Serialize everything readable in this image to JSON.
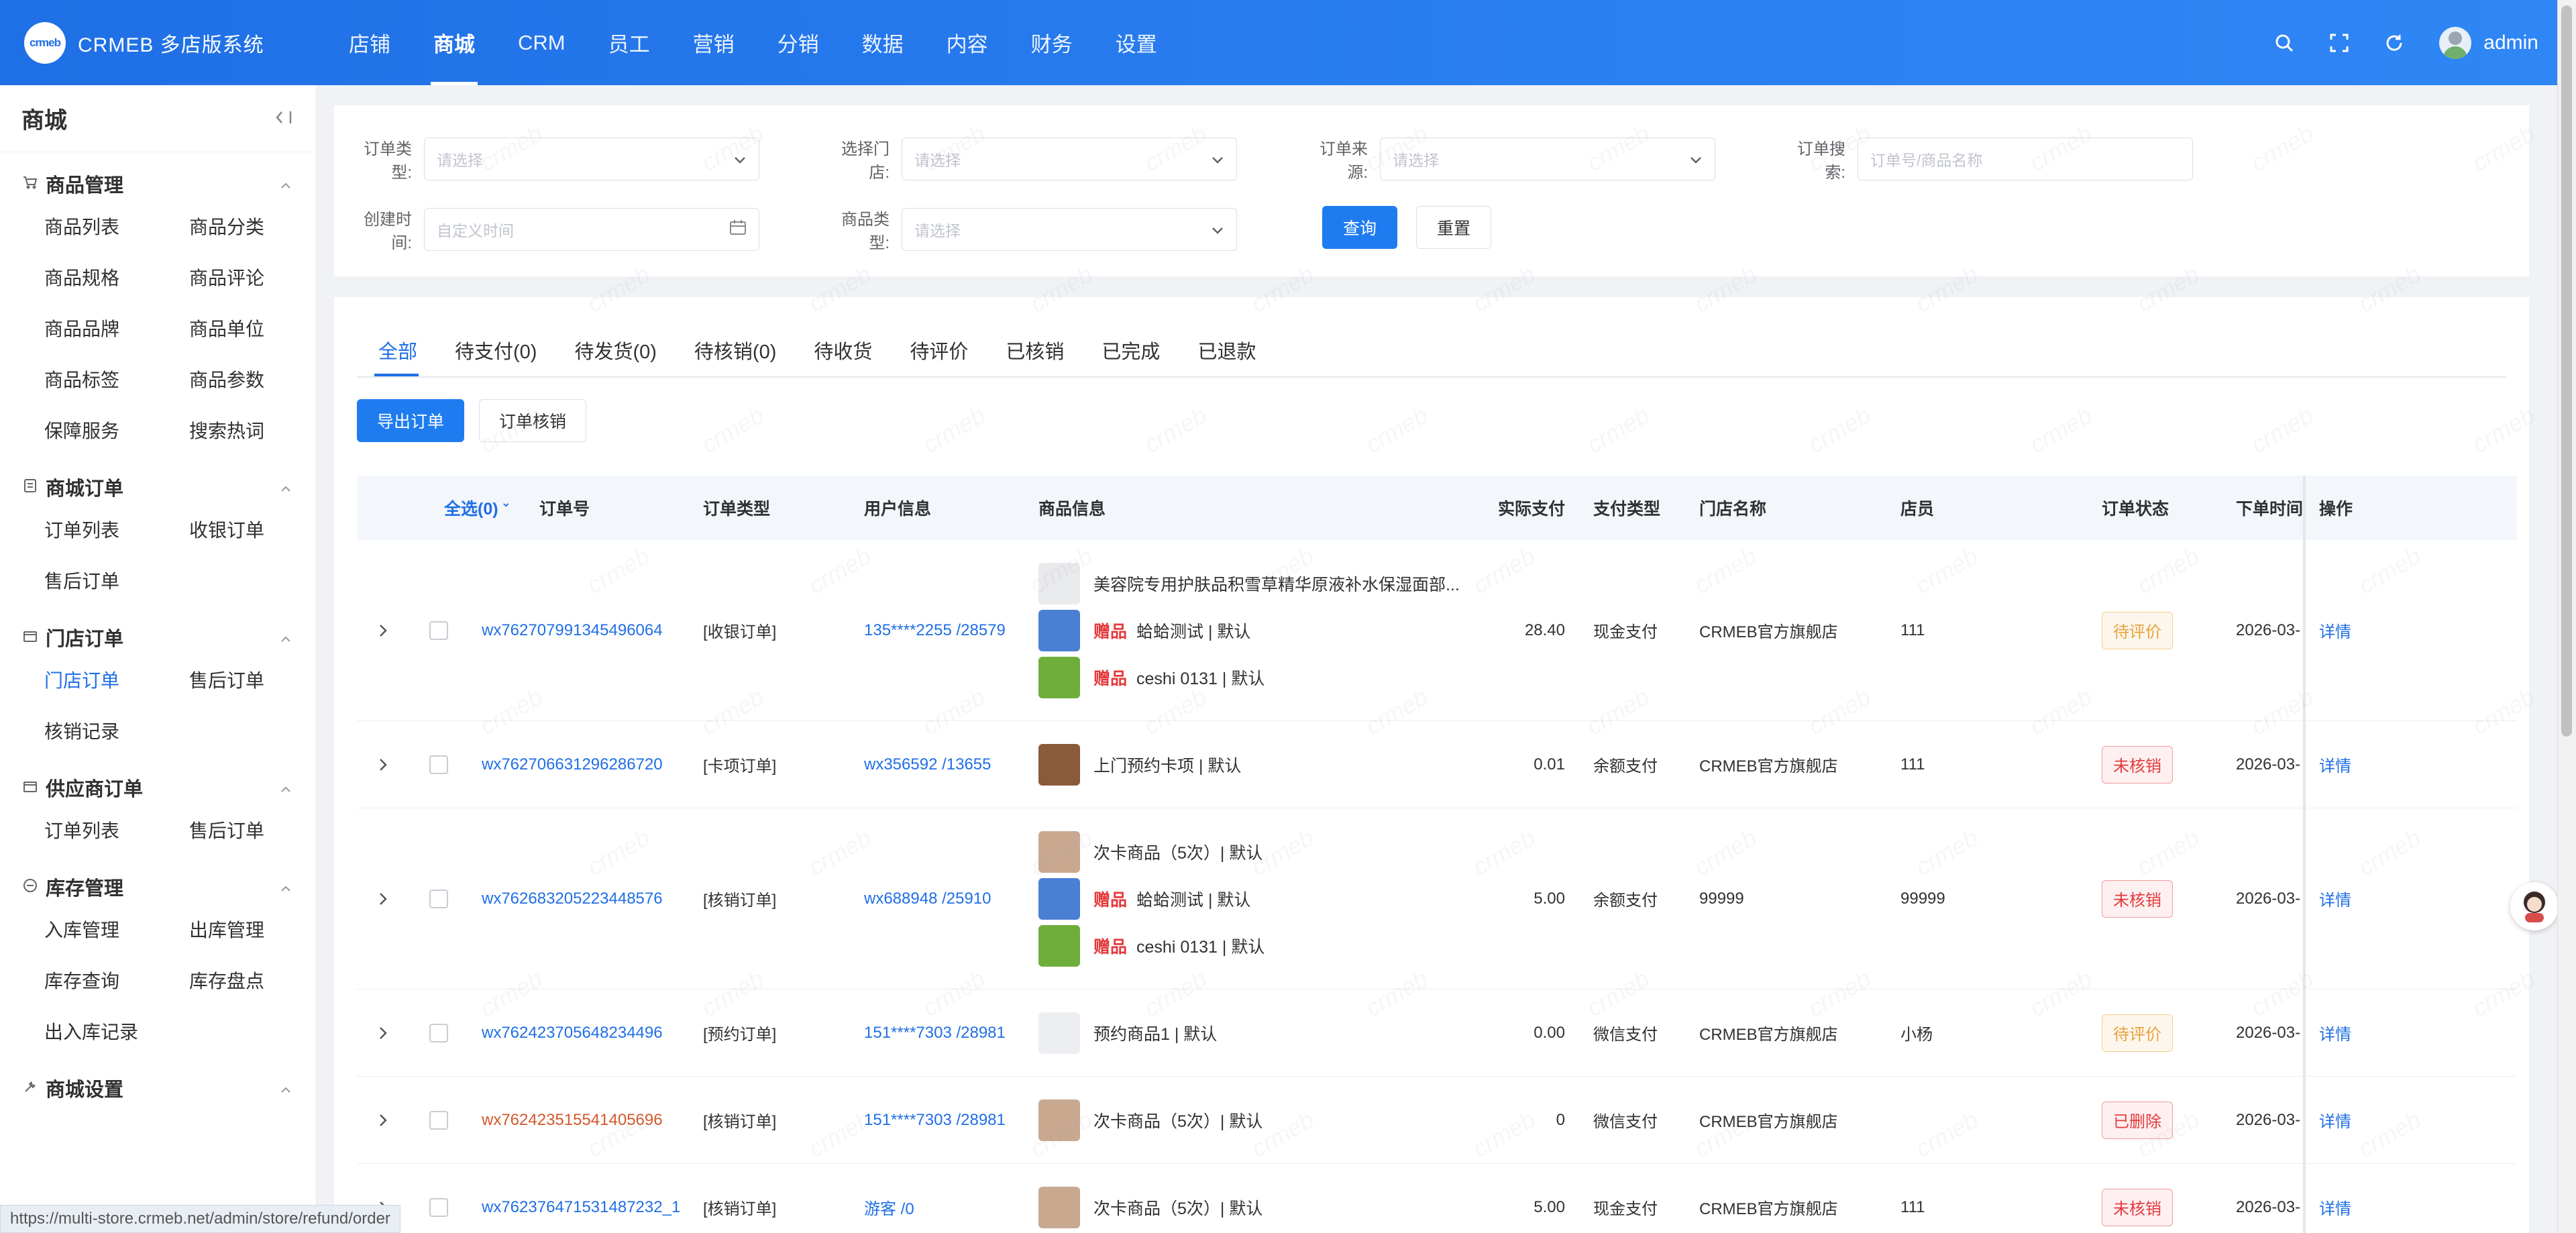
{
  "app": {
    "brand": "CRMEB 多店版系统",
    "logo_text": "crmeb"
  },
  "topnav": [
    "店铺",
    "商城",
    "CRM",
    "员工",
    "营销",
    "分销",
    "数据",
    "内容",
    "财务",
    "设置"
  ],
  "topnav_active": 1,
  "user": {
    "name": "admin"
  },
  "sidebar": {
    "title": "商城",
    "groups": [
      {
        "label": "商品管理",
        "icon": "cart-icon",
        "items": [
          "商品列表",
          "商品分类",
          "商品规格",
          "商品评论",
          "商品品牌",
          "商品单位",
          "商品标签",
          "商品参数",
          "保障服务",
          "搜索热词"
        ]
      },
      {
        "label": "商城订单",
        "icon": "list-icon",
        "items": [
          "订单列表",
          "收银订单",
          "售后订单"
        ]
      },
      {
        "label": "门店订单",
        "icon": "box-icon",
        "items": [
          "门店订单",
          "售后订单",
          "核销记录"
        ],
        "active_item": 0
      },
      {
        "label": "供应商订单",
        "icon": "box-icon",
        "items": [
          "订单列表",
          "售后订单"
        ]
      },
      {
        "label": "库存管理",
        "icon": "stock-icon",
        "items": [
          "入库管理",
          "出库管理",
          "库存查询",
          "库存盘点",
          "出入库记录"
        ]
      },
      {
        "label": "商城设置",
        "icon": "wrench-icon",
        "items": []
      }
    ]
  },
  "filters": {
    "order_type": {
      "label": "订单类型:",
      "placeholder": "请选择"
    },
    "store": {
      "label": "选择门店:",
      "placeholder": "请选择"
    },
    "source": {
      "label": "订单来源:",
      "placeholder": "请选择"
    },
    "search": {
      "label": "订单搜索:",
      "placeholder": "订单号/商品名称"
    },
    "created": {
      "label": "创建时间:",
      "placeholder": "自定义时间"
    },
    "goods_type": {
      "label": "商品类型:",
      "placeholder": "请选择"
    },
    "query_label": "查询",
    "reset_label": "重置"
  },
  "tabs": [
    "全部",
    "待支付(0)",
    "待发货(0)",
    "待核销(0)",
    "待收货",
    "待评价",
    "已核销",
    "已完成",
    "已退款"
  ],
  "tab_active": 0,
  "actions": {
    "export": "导出订单",
    "verify": "订单核销"
  },
  "columns": {
    "select_all": "全选(0)",
    "order_no": "订单号",
    "order_type": "订单类型",
    "user": "用户信息",
    "goods": "商品信息",
    "paid": "实际支付",
    "pay_type": "支付类型",
    "store": "门店名称",
    "staff": "店员",
    "status": "订单状态",
    "time": "下单时间",
    "op": "操作"
  },
  "rows": [
    {
      "order_no": "wx762707991345496064",
      "type": "[收银订单]",
      "user": "135****2255 /28579",
      "goods": [
        {
          "gift": "",
          "name": "美容院专用护肤品积雪草精华原液补水保湿面部...",
          "img": "#e9eaec"
        },
        {
          "gift": "赠品",
          "name": "蛤蛤测试 | 默认",
          "img": "#4a7fd4"
        },
        {
          "gift": "赠品",
          "name": "ceshi 0131 | 默认",
          "img": "#6fae3b"
        }
      ],
      "paid": "28.40",
      "pay_type": "现金支付",
      "store": "CRMEB官方旗舰店",
      "staff": "111",
      "status": "待评价",
      "status_kind": "warn",
      "time": "2026-03-",
      "op": "详情",
      "no_red": false
    },
    {
      "order_no": "wx762706631296286720",
      "type": "[卡项订单]",
      "user": "wx356592 /13655",
      "goods": [
        {
          "gift": "",
          "name": "上门预约卡项 | 默认",
          "img": "#8a5a3a"
        }
      ],
      "paid": "0.01",
      "pay_type": "余额支付",
      "store": "CRMEB官方旗舰店",
      "staff": "111",
      "status": "未核销",
      "status_kind": "red",
      "time": "2026-03-",
      "op": "详情",
      "no_red": false
    },
    {
      "order_no": "wx762683205223448576",
      "type": "[核销订单]",
      "user": "wx688948 /25910",
      "goods": [
        {
          "gift": "",
          "name": "次卡商品（5次）| 默认",
          "img": "#c9a890"
        },
        {
          "gift": "赠品",
          "name": "蛤蛤测试 | 默认",
          "img": "#4a7fd4"
        },
        {
          "gift": "赠品",
          "name": "ceshi 0131 | 默认",
          "img": "#6fae3b"
        }
      ],
      "paid": "5.00",
      "pay_type": "余额支付",
      "store": "99999",
      "staff": "99999",
      "status": "未核销",
      "status_kind": "red",
      "time": "2026-03-",
      "op": "详情",
      "no_red": false
    },
    {
      "order_no": "wx762423705648234496",
      "type": "[预约订单]",
      "user": "151****7303 /28981",
      "goods": [
        {
          "gift": "",
          "name": "预约商品1 | 默认",
          "img": "#eceef1"
        }
      ],
      "paid": "0.00",
      "pay_type": "微信支付",
      "store": "CRMEB官方旗舰店",
      "staff": "小杨",
      "status": "待评价",
      "status_kind": "warn",
      "time": "2026-03-",
      "op": "详情",
      "no_red": false
    },
    {
      "order_no": "wx762423515541405696",
      "type": "[核销订单]",
      "user": "151****7303 /28981",
      "goods": [
        {
          "gift": "",
          "name": "次卡商品（5次）| 默认",
          "img": "#c9a890"
        }
      ],
      "paid": "0",
      "pay_type": "微信支付",
      "store": "CRMEB官方旗舰店",
      "staff": "",
      "status": "已删除",
      "status_kind": "red",
      "time": "2026-03-",
      "op": "详情",
      "no_red": true
    },
    {
      "order_no": "wx762376471531487232_1",
      "type": "[核销订单]",
      "user": "游客 /0",
      "goods": [
        {
          "gift": "",
          "name": "次卡商品（5次）| 默认",
          "img": "#c9a890"
        }
      ],
      "paid": "5.00",
      "pay_type": "现金支付",
      "store": "CRMEB官方旗舰店",
      "staff": "111",
      "status": "未核销",
      "status_kind": "red",
      "time": "2026-03-",
      "op": "详情",
      "no_red": false
    }
  ],
  "statusbar": "https://multi-store.crmeb.net/admin/store/refund/order",
  "watermark": "crmeb"
}
